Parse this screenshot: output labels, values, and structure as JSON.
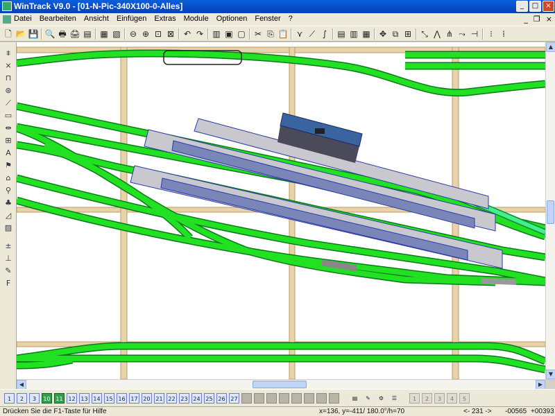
{
  "window": {
    "title": "WinTrack  V9.0 - [01-N-Pic-340X100-0-Alles]"
  },
  "window_controls": {
    "minimize": "_",
    "maximize": "□",
    "close": "×"
  },
  "menu": [
    "Datei",
    "Bearbeiten",
    "Ansicht",
    "Einfügen",
    "Extras",
    "Module",
    "Optionen",
    "Fenster",
    "?"
  ],
  "mdi_controls": {
    "minimize": "_",
    "restore": "❐",
    "close": "×"
  },
  "toolbar": [
    {
      "name": "new-icon",
      "glyph": "🗋"
    },
    {
      "name": "open-icon",
      "glyph": "📂"
    },
    {
      "name": "save-icon",
      "glyph": "💾"
    },
    {
      "name": "print-preview-icon",
      "glyph": "🔍"
    },
    {
      "name": "print-icon",
      "glyph": "🖶"
    },
    {
      "name": "printer-setup-icon",
      "glyph": "🖨"
    },
    {
      "name": "list-icon",
      "glyph": "▤"
    },
    {
      "name": "layout-3d-icon",
      "glyph": "▦"
    },
    {
      "name": "landscape-icon",
      "glyph": "▧"
    },
    {
      "name": "zoom-out-icon",
      "glyph": "⊖"
    },
    {
      "name": "zoom-in-icon",
      "glyph": "⊕"
    },
    {
      "name": "zoom-window-icon",
      "glyph": "⊡"
    },
    {
      "name": "zoom-all-icon",
      "glyph": "⊠"
    },
    {
      "name": "undo-icon",
      "glyph": "↶"
    },
    {
      "name": "redo-icon",
      "glyph": "↷"
    },
    {
      "name": "parts-list-icon",
      "glyph": "▥"
    },
    {
      "name": "catalog-icon",
      "glyph": "▣"
    },
    {
      "name": "properties-icon",
      "glyph": "▢"
    },
    {
      "name": "cut-icon",
      "glyph": "✂"
    },
    {
      "name": "copy-icon",
      "glyph": "⎘"
    },
    {
      "name": "paste-icon",
      "glyph": "📋"
    },
    {
      "name": "switch-icon",
      "glyph": "⋎"
    },
    {
      "name": "curve-icon",
      "glyph": "⟋"
    },
    {
      "name": "flex-track-icon",
      "glyph": "∫"
    },
    {
      "name": "group-icon",
      "glyph": "▤"
    },
    {
      "name": "ungroup-icon",
      "glyph": "▥"
    },
    {
      "name": "block-icon",
      "glyph": "▦"
    },
    {
      "name": "connect-icon",
      "glyph": "✥"
    },
    {
      "name": "align-icon",
      "glyph": "⧉"
    },
    {
      "name": "build-icon",
      "glyph": "⊞"
    },
    {
      "name": "measure-icon",
      "glyph": "⤡"
    },
    {
      "name": "turnout-icon",
      "glyph": "⋀"
    },
    {
      "name": "split-icon",
      "glyph": "⋔"
    },
    {
      "name": "junction-icon",
      "glyph": "⤳"
    },
    {
      "name": "end-icon",
      "glyph": "⊣"
    },
    {
      "name": "grid-icon",
      "glyph": "⁝"
    },
    {
      "name": "snap-icon",
      "glyph": "⁞"
    }
  ],
  "left_tools": [
    {
      "name": "track-tool-icon",
      "glyph": "⩨"
    },
    {
      "name": "crossing-tool-icon",
      "glyph": "⨯"
    },
    {
      "name": "bridge-tool-icon",
      "glyph": "⊓"
    },
    {
      "name": "turntable-tool-icon",
      "glyph": "⊛"
    },
    {
      "name": "slope-tool-icon",
      "glyph": "⟋"
    },
    {
      "name": "platform-tool-icon",
      "glyph": "▭"
    },
    {
      "name": "dimension-tool-icon",
      "glyph": "⇹"
    },
    {
      "name": "table-tool-icon",
      "glyph": "⊞"
    },
    {
      "name": "text-tool-icon",
      "glyph": "A"
    },
    {
      "name": "signal-tool-icon",
      "glyph": "⚑"
    },
    {
      "name": "house-tool-icon",
      "glyph": "⌂"
    },
    {
      "name": "figure-tool-icon",
      "glyph": "⚲"
    },
    {
      "name": "tree-tool-icon",
      "glyph": "♣"
    },
    {
      "name": "gradient-tool-icon",
      "glyph": "◿"
    },
    {
      "name": "terrain-tool-icon",
      "glyph": "▨"
    },
    {
      "name": "height-tool-icon",
      "glyph": "±"
    },
    {
      "name": "section-tool-icon",
      "glyph": "⊥"
    },
    {
      "name": "paint-tool-icon",
      "glyph": "✎"
    },
    {
      "name": "font-tool-icon",
      "glyph": "F"
    }
  ],
  "layers": [
    {
      "label": "1",
      "style": "blue"
    },
    {
      "label": "2",
      "style": "blue"
    },
    {
      "label": "3",
      "style": "blue"
    },
    {
      "label": "10",
      "style": "on"
    },
    {
      "label": "11",
      "style": "on"
    },
    {
      "label": "12",
      "style": "blue"
    },
    {
      "label": "13",
      "style": "blue"
    },
    {
      "label": "14",
      "style": "blue"
    },
    {
      "label": "15",
      "style": "blue"
    },
    {
      "label": "16",
      "style": "blue"
    },
    {
      "label": "17",
      "style": "blue"
    },
    {
      "label": "20",
      "style": "blue"
    },
    {
      "label": "21",
      "style": "blue"
    },
    {
      "label": "22",
      "style": "blue"
    },
    {
      "label": "23",
      "style": "blue"
    },
    {
      "label": "24",
      "style": "blue"
    },
    {
      "label": "25",
      "style": "blue"
    },
    {
      "label": "26",
      "style": "blue"
    },
    {
      "label": "27",
      "style": "blue"
    },
    {
      "label": "",
      "style": "gray"
    },
    {
      "label": "",
      "style": "gray"
    },
    {
      "label": "",
      "style": "gray"
    },
    {
      "label": "",
      "style": "gray"
    },
    {
      "label": "",
      "style": "gray"
    },
    {
      "label": "",
      "style": "gray"
    },
    {
      "label": "",
      "style": "gray"
    },
    {
      "label": "",
      "style": "gray"
    }
  ],
  "layer_extra_icons": [
    {
      "name": "color-layer-icon",
      "glyph": "▤"
    },
    {
      "name": "edit-layer-icon",
      "glyph": "✎"
    },
    {
      "name": "layer-settings-icon",
      "glyph": "⚙"
    },
    {
      "name": "stack-icon",
      "glyph": "☰"
    }
  ],
  "level_buttons": [
    "1",
    "2",
    "3",
    "4",
    "5"
  ],
  "status": {
    "help": "Drücken Sie die  F1-Taste für Hilfe",
    "coords": "x=136, y=-411/ 180.0°/h=70",
    "page": "<- 231 ->",
    "x_offset": "-00565",
    "y_offset": "+00393"
  },
  "colors": {
    "track": "#22e022",
    "track_light": "#55ee66",
    "frame": "#e8d2a8",
    "platform": "#7a86b8",
    "building": "#3a64a0",
    "titlebar": "#0a5fdc"
  }
}
